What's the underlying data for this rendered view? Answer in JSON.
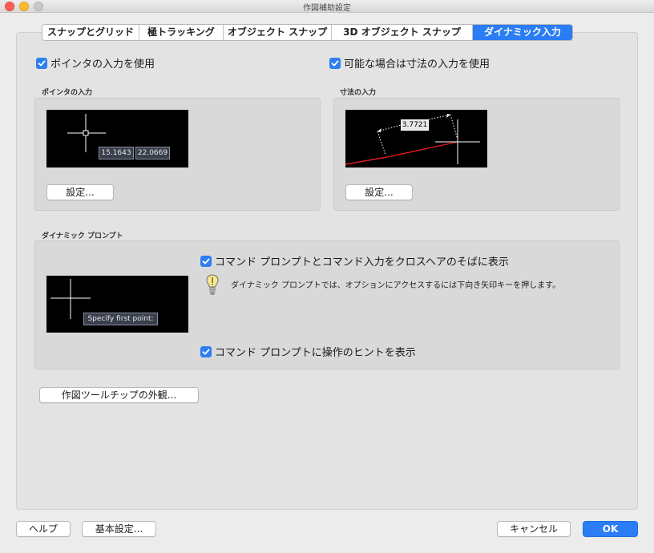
{
  "window": {
    "title": "作図補助設定"
  },
  "tabs": [
    {
      "label": "スナップとグリッド"
    },
    {
      "label": "極トラッキング"
    },
    {
      "label": "オブジェクト スナップ"
    },
    {
      "label": "3D オブジェクト スナップ"
    },
    {
      "label": "ダイナミック入力"
    }
  ],
  "active_tab": "ダイナミック入力",
  "pointer_input": {
    "enable_label": "ポインタの入力を使用",
    "checked": true,
    "group_title": "ポインタの入力",
    "preview_x": "15.1643",
    "preview_y": "22.0669",
    "settings_button": "設定..."
  },
  "dimension_input": {
    "enable_label": "可能な場合は寸法の入力を使用",
    "checked": true,
    "group_title": "寸法の入力",
    "preview_value": "3.7721",
    "settings_button": "設定..."
  },
  "dynamic_prompt": {
    "group_title": "ダイナミック プロンプト",
    "show_near_crosshair_label": "コマンド プロンプトとコマンド入力をクロスヘアのそばに表示",
    "show_near_crosshair_checked": true,
    "tip": "ダイナミック プロンプトでは、オプションにアクセスするには下向き矢印キーを押します。",
    "preview_prompt": "Specify first point:",
    "show_hints_label": "コマンド プロンプトに操作のヒントを表示",
    "show_hints_checked": true
  },
  "tooltip_appearance_button": "作図ツールチップの外観...",
  "footer": {
    "help_button": "ヘルプ",
    "defaults_button": "基本設定...",
    "cancel_button": "キャンセル",
    "ok_button": "OK"
  },
  "colors": {
    "accent": "#2a7df5",
    "preview_background": "#000000",
    "dimension_line": "#e01b1b"
  },
  "icons": [
    "close-icon",
    "minimize-icon",
    "maximize-icon",
    "checkbox-checked-icon",
    "lightbulb-icon",
    "crosshair-icon"
  ]
}
